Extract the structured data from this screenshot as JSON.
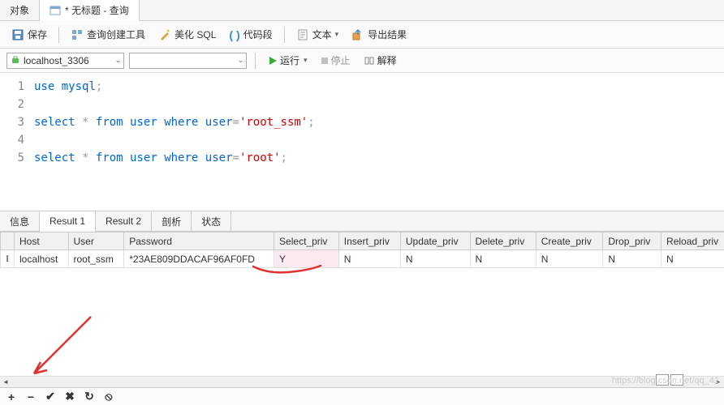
{
  "topTabs": {
    "objects": "对象",
    "query": "* 无标题 - 查询"
  },
  "toolbar": {
    "save": "保存",
    "queryBuilder": "查询创建工具",
    "beautifySql": "美化 SQL",
    "codeSnippet": "代码段",
    "text": "文本",
    "exportResult": "导出结果"
  },
  "connBar": {
    "connection": "localhost_3306",
    "run": "运行",
    "stop": "停止",
    "explain": "解释"
  },
  "editor": {
    "lines": [
      {
        "n": 1,
        "tokens": [
          [
            "kw",
            "use"
          ],
          [
            "",
            ""
          ],
          [
            "kw",
            "mysql"
          ],
          [
            "punct",
            ";"
          ]
        ]
      },
      {
        "n": 2,
        "tokens": []
      },
      {
        "n": 3,
        "tokens": [
          [
            "kw",
            "select"
          ],
          [
            "",
            " "
          ],
          [
            "punct",
            "*"
          ],
          [
            "",
            " "
          ],
          [
            "kw",
            "from"
          ],
          [
            "",
            " "
          ],
          [
            "kw",
            "user"
          ],
          [
            "",
            " "
          ],
          [
            "kw",
            "where"
          ],
          [
            "",
            " "
          ],
          [
            "kw",
            "user"
          ],
          [
            "punct",
            "="
          ],
          [
            "str",
            "'root_ssm'"
          ],
          [
            "punct",
            ";"
          ]
        ]
      },
      {
        "n": 4,
        "tokens": []
      },
      {
        "n": 5,
        "tokens": [
          [
            "kw",
            "select"
          ],
          [
            "",
            " "
          ],
          [
            "punct",
            "*"
          ],
          [
            "",
            " "
          ],
          [
            "kw",
            "from"
          ],
          [
            "",
            " "
          ],
          [
            "kw",
            "user"
          ],
          [
            "",
            " "
          ],
          [
            "kw",
            "where"
          ],
          [
            "",
            " "
          ],
          [
            "kw",
            "user"
          ],
          [
            "punct",
            "="
          ],
          [
            "str",
            "'root'"
          ],
          [
            "punct",
            ";"
          ]
        ]
      }
    ]
  },
  "resultTabs": {
    "info": "信息",
    "result1": "Result 1",
    "result2": "Result 2",
    "profile": "剖析",
    "status": "状态"
  },
  "grid": {
    "columns": [
      "Host",
      "User",
      "Password",
      "Select_priv",
      "Insert_priv",
      "Update_priv",
      "Delete_priv",
      "Create_priv",
      "Drop_priv",
      "Reload_priv"
    ],
    "rows": [
      {
        "Host": "localhost",
        "User": "root_ssm",
        "Password": "*23AE809DDACAF96AF0FD",
        "Select_priv": "Y",
        "Insert_priv": "N",
        "Update_priv": "N",
        "Delete_priv": "N",
        "Create_priv": "N",
        "Drop_priv": "N",
        "Reload_priv": "N"
      }
    ],
    "editingCell": {
      "row": 0,
      "col": "Select_priv"
    }
  },
  "watermark": "https://blog.csdn.net/qq_41"
}
